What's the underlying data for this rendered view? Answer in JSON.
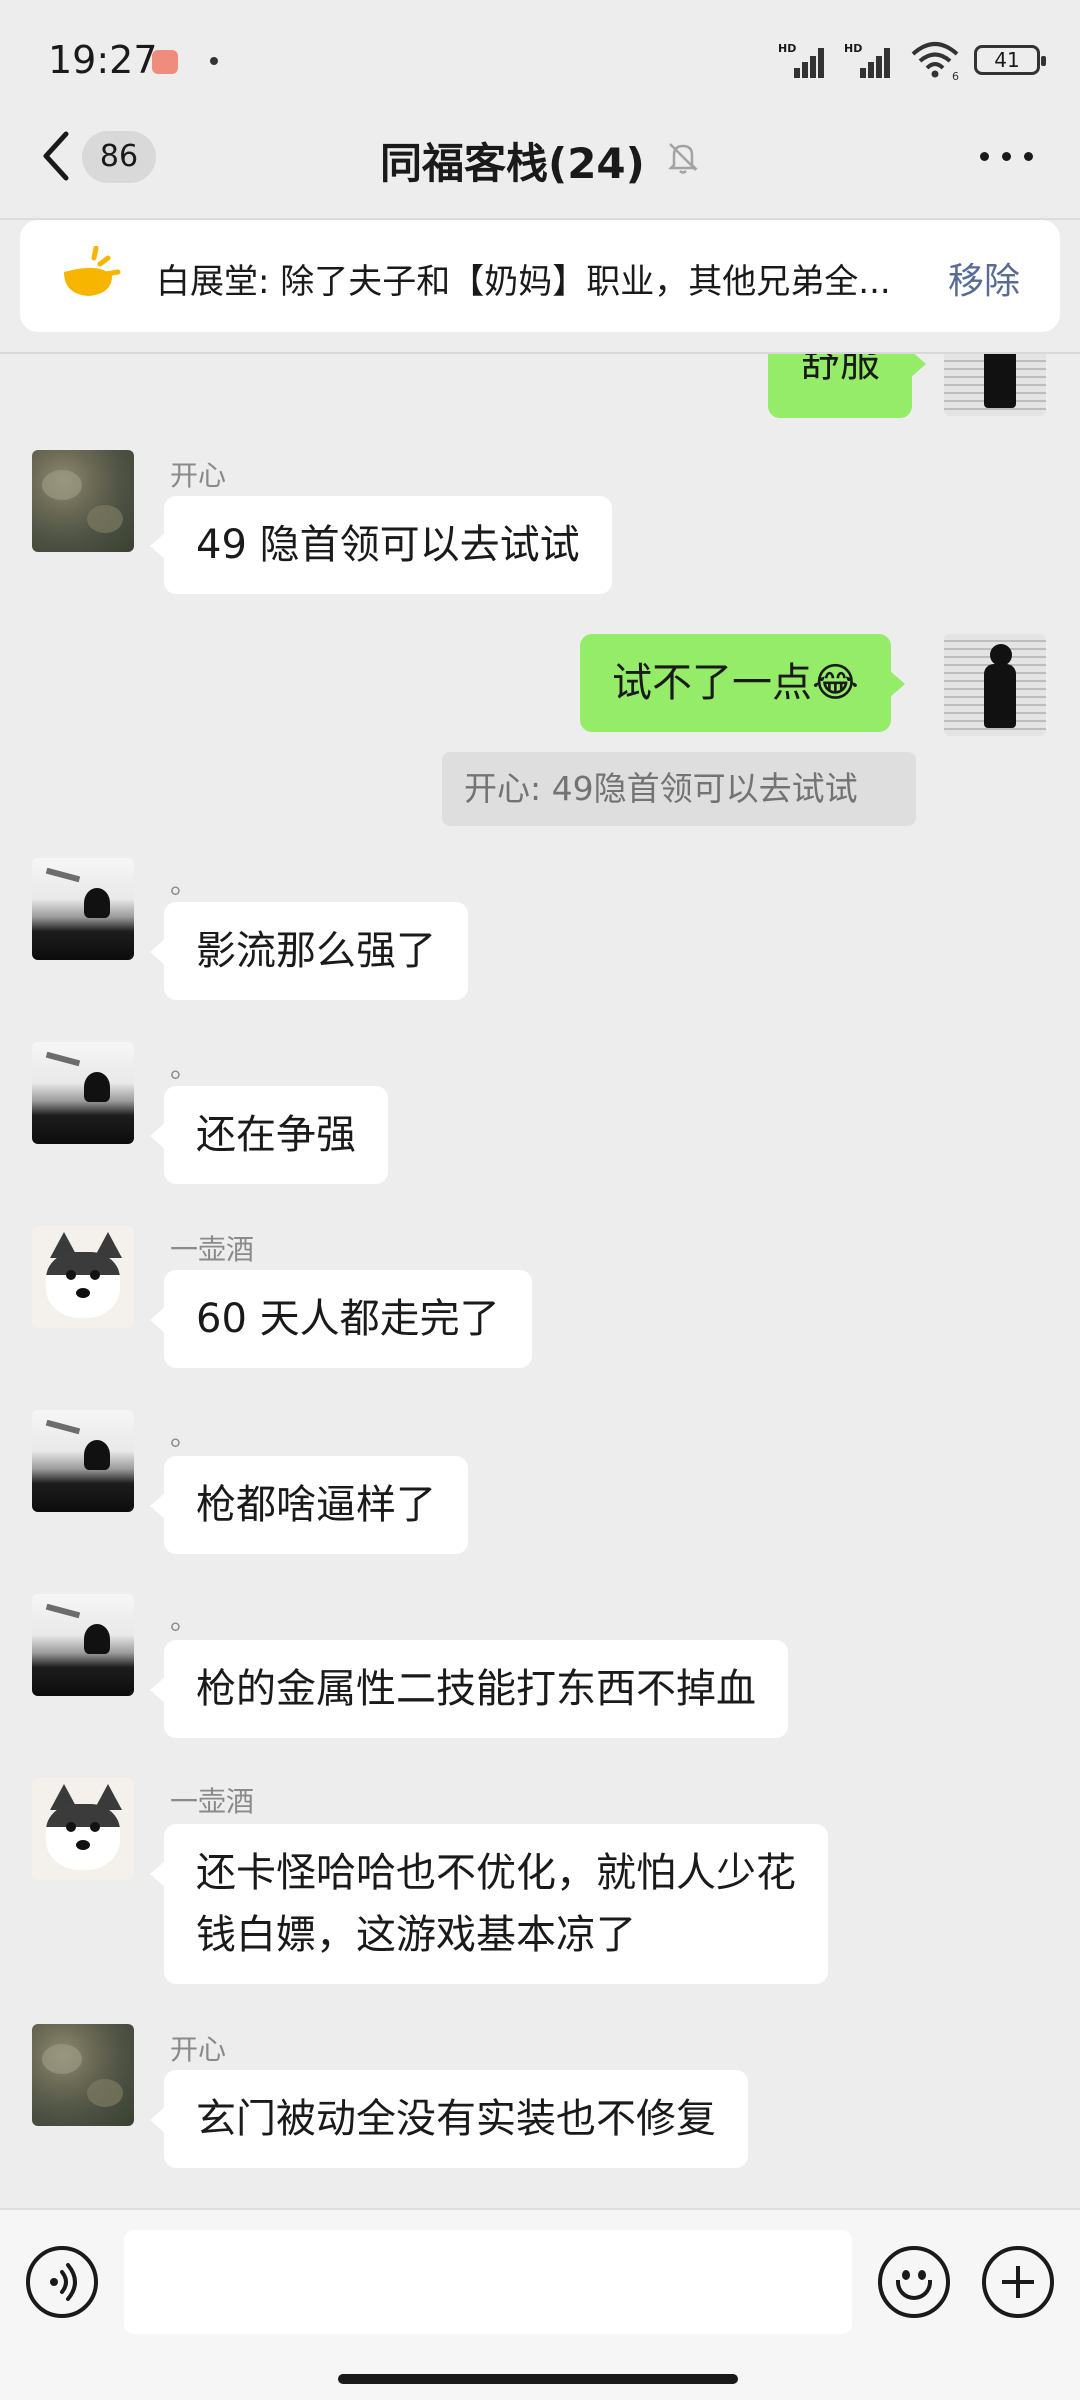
{
  "status_bar": {
    "time": "19:27",
    "battery": "41",
    "signal_labels": [
      "HD",
      "HD"
    ],
    "wifi_label": "6"
  },
  "header": {
    "back_count": "86",
    "title": "同福客栈(24)",
    "more_icon": "more-icon",
    "mute_icon": "bell-off-icon"
  },
  "announcement": {
    "text": "白展堂: 除了夫子和【奶妈】职业，其他兄弟全...",
    "remove_label": "移除"
  },
  "messages": [
    {
      "side": "right",
      "text": "舒服",
      "avatar": "self-silhouette"
    },
    {
      "side": "left",
      "sender": "开心",
      "text": "49 隐首领可以去试试",
      "avatar": "stone"
    },
    {
      "side": "right",
      "text": "试不了一点😂",
      "avatar": "self-silhouette"
    },
    {
      "side": "quote",
      "text": "开心: 49隐首领可以去试试"
    },
    {
      "side": "left",
      "sender": "。",
      "text": "影流那么强了",
      "avatar": "sunset"
    },
    {
      "side": "left",
      "sender": "。",
      "text": "还在争强",
      "avatar": "sunset"
    },
    {
      "side": "left",
      "sender": "一壶酒",
      "text": "60 天人都走完了",
      "avatar": "husky"
    },
    {
      "side": "left",
      "sender": "。",
      "text": "枪都啥逼样了",
      "avatar": "sunset"
    },
    {
      "side": "left",
      "sender": "。",
      "text": "枪的金属性二技能打东西不掉血",
      "avatar": "sunset"
    },
    {
      "side": "left",
      "sender": "一壶酒",
      "text": "还卡怪哈哈也不优化，就怕人少花\n钱白嫖，这游戏基本凉了",
      "avatar": "husky"
    },
    {
      "side": "left",
      "sender": "开心",
      "text": "玄门被动全没有实装也不修复",
      "avatar": "stone"
    }
  ],
  "colors": {
    "background": "#ededed",
    "self_bubble": "#95ec69",
    "other_bubble": "#ffffff",
    "link": "#576b95"
  }
}
